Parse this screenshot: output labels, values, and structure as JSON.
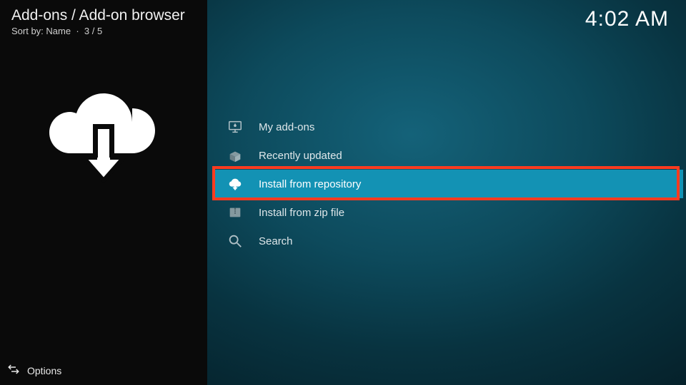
{
  "header": {
    "breadcrumb": "Add-ons / Add-on browser",
    "sort_label": "Sort by: Name",
    "position": "3 / 5"
  },
  "clock": "4:02 AM",
  "menu": {
    "items": [
      {
        "label": "My add-ons",
        "icon": "monitor-icon"
      },
      {
        "label": "Recently updated",
        "icon": "box-open-icon"
      },
      {
        "label": "Install from repository",
        "icon": "cloud-download-icon",
        "selected": true
      },
      {
        "label": "Install from zip file",
        "icon": "zip-icon"
      },
      {
        "label": "Search",
        "icon": "search-icon"
      }
    ]
  },
  "footer": {
    "options_label": "Options"
  },
  "annotation": {
    "highlight_index": 2
  }
}
